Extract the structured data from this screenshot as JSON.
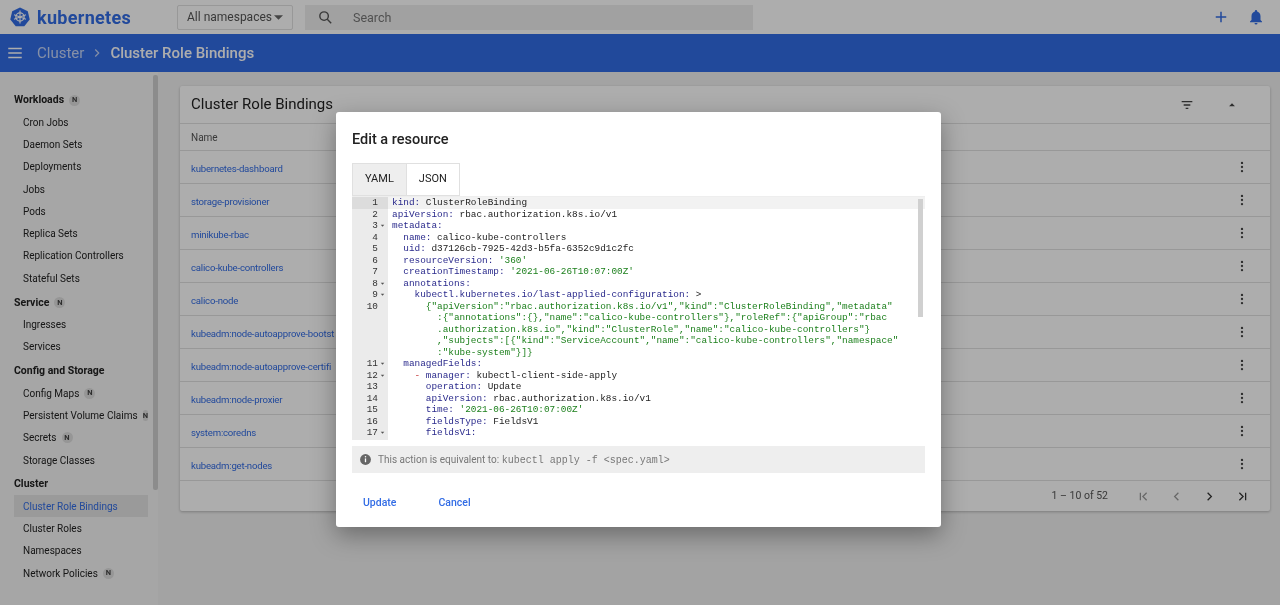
{
  "header": {
    "brand": "kubernetes",
    "namespace_select": "All namespaces",
    "search": {
      "placeholder": "Search"
    }
  },
  "breadcrumb": [
    {
      "label": "Cluster",
      "current": false
    },
    {
      "label": "Cluster Role Bindings",
      "current": true
    }
  ],
  "sidebar": {
    "groups": [
      {
        "title": "Workloads",
        "badge": "N",
        "items": [
          {
            "label": "Cron Jobs",
            "selected": false
          },
          {
            "label": "Daemon Sets",
            "selected": false
          },
          {
            "label": "Deployments",
            "selected": false
          },
          {
            "label": "Jobs",
            "selected": false
          },
          {
            "label": "Pods",
            "selected": false
          },
          {
            "label": "Replica Sets",
            "selected": false
          },
          {
            "label": "Replication Controllers",
            "selected": false
          },
          {
            "label": "Stateful Sets",
            "selected": false
          }
        ]
      },
      {
        "title": "Service",
        "badge": "N",
        "items": [
          {
            "label": "Ingresses",
            "selected": false
          },
          {
            "label": "Services",
            "selected": false
          }
        ]
      },
      {
        "title": "Config and Storage",
        "items": [
          {
            "label": "Config Maps",
            "badge": "N",
            "selected": false
          },
          {
            "label": "Persistent Volume Claims",
            "badge": "N",
            "selected": false
          },
          {
            "label": "Secrets",
            "badge": "N",
            "selected": false
          },
          {
            "label": "Storage Classes",
            "selected": false
          }
        ]
      },
      {
        "title": "Cluster",
        "items": [
          {
            "label": "Cluster Role Bindings",
            "selected": true
          },
          {
            "label": "Cluster Roles",
            "selected": false
          },
          {
            "label": "Namespaces",
            "selected": false
          },
          {
            "label": "Network Policies",
            "badge": "N",
            "selected": false
          }
        ]
      }
    ]
  },
  "table": {
    "title": "Cluster Role Bindings",
    "columns": [
      "Name"
    ],
    "rows": [
      "kubernetes-dashboard",
      "storage-provisioner",
      "minikube-rbac",
      "calico-kube-controllers",
      "calico-node",
      "kubeadm:node-autoapprove-bootst",
      "kubeadm:node-autoapprove-certifi",
      "kubeadm:node-proxier",
      "system:coredns",
      "kubeadm:get-nodes"
    ],
    "pagination": "1 – 10 of 52"
  },
  "dialog": {
    "title": "Edit a resource",
    "tabs": [
      {
        "label": "YAML",
        "selected": true
      },
      {
        "label": "JSON",
        "selected": false
      }
    ],
    "code": [
      {
        "number": "1",
        "fold": false,
        "tokens": [
          {
            "kind": "key",
            "text": "kind:"
          },
          {
            "kind": "plain",
            "text": " ClusterRoleBinding"
          }
        ]
      },
      {
        "number": "2",
        "fold": false,
        "tokens": [
          {
            "kind": "key",
            "text": "apiVersion:"
          },
          {
            "kind": "plain",
            "text": " rbac.authorization.k8s.io/v1"
          }
        ]
      },
      {
        "number": "3",
        "fold": true,
        "tokens": [
          {
            "kind": "key",
            "text": "metadata:"
          }
        ]
      },
      {
        "number": "4",
        "fold": false,
        "tokens": [
          {
            "kind": "key",
            "text": "  name:"
          },
          {
            "kind": "plain",
            "text": " calico-kube-controllers"
          }
        ]
      },
      {
        "number": "5",
        "fold": false,
        "tokens": [
          {
            "kind": "key",
            "text": "  uid:"
          },
          {
            "kind": "plain",
            "text": " d37126cb-7925-42d3-b5fa-6352c9d1c2fc"
          }
        ]
      },
      {
        "number": "6",
        "fold": false,
        "tokens": [
          {
            "kind": "key",
            "text": "  resourceVersion:"
          },
          {
            "kind": "string",
            "text": " '360'"
          }
        ]
      },
      {
        "number": "7",
        "fold": false,
        "tokens": [
          {
            "kind": "key",
            "text": "  creationTimestamp:"
          },
          {
            "kind": "string",
            "text": " '2021-06-26T10:07:00Z'"
          }
        ]
      },
      {
        "number": "8",
        "fold": true,
        "tokens": [
          {
            "kind": "key",
            "text": "  annotations:"
          }
        ]
      },
      {
        "number": "9",
        "fold": true,
        "tokens": [
          {
            "kind": "key",
            "text": "    kubectl.kubernetes.io/last-applied-configuration:"
          },
          {
            "kind": "plain",
            "text": " >"
          }
        ]
      },
      {
        "number": "10",
        "fold": false,
        "tokens": [
          {
            "kind": "string",
            "text": "      {\"apiVersion\":\"rbac.authorization.k8s.io/v1\",\"kind\":\"ClusterRoleBinding\",\"metadata\""
          }
        ],
        "wrapped": [
          ":{\"annotations\":{},\"name\":\"calico-kube-controllers\"},\"roleRef\":{\"apiGroup\":\"rbac",
          ".authorization.k8s.io\",\"kind\":\"ClusterRole\",\"name\":\"calico-kube-controllers\"}",
          ",\"subjects\":[{\"kind\":\"ServiceAccount\",\"name\":\"calico-kube-controllers\",\"namespace\"",
          ":\"kube-system\"}]}"
        ]
      },
      {
        "number": "11",
        "fold": true,
        "tokens": [
          {
            "kind": "key",
            "text": "  managedFields:"
          }
        ]
      },
      {
        "number": "12",
        "fold": true,
        "tokens": [
          {
            "kind": "dash",
            "text": "    -"
          },
          {
            "kind": "key",
            "text": " manager:"
          },
          {
            "kind": "plain",
            "text": " kubectl-client-side-apply"
          }
        ]
      },
      {
        "number": "13",
        "fold": false,
        "tokens": [
          {
            "kind": "key",
            "text": "      operation:"
          },
          {
            "kind": "plain",
            "text": " Update"
          }
        ]
      },
      {
        "number": "14",
        "fold": false,
        "tokens": [
          {
            "kind": "key",
            "text": "      apiVersion:"
          },
          {
            "kind": "plain",
            "text": " rbac.authorization.k8s.io/v1"
          }
        ]
      },
      {
        "number": "15",
        "fold": false,
        "tokens": [
          {
            "kind": "key",
            "text": "      time:"
          },
          {
            "kind": "string",
            "text": " '2021-06-26T10:07:00Z'"
          }
        ]
      },
      {
        "number": "16",
        "fold": false,
        "tokens": [
          {
            "kind": "key",
            "text": "      fieldsType:"
          },
          {
            "kind": "plain",
            "text": " FieldsV1"
          }
        ]
      },
      {
        "number": "17",
        "fold": true,
        "tokens": [
          {
            "kind": "key",
            "text": "      fieldsV1:"
          }
        ]
      }
    ],
    "info": {
      "text": "This action is equivalent to:",
      "command": "kubectl apply -f <spec.yaml>"
    },
    "buttons": [
      "Update",
      "Cancel"
    ]
  }
}
